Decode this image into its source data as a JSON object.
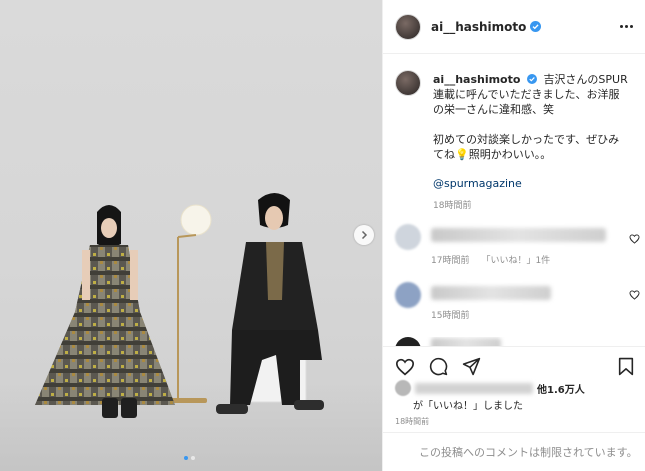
{
  "post": {
    "username": "ai__hashimoto",
    "image_alt": "photo",
    "carousel_dots": 2
  },
  "caption": {
    "username": "ai__hashimoto",
    "text": "吉沢さんのSPUR連載に呼んでいただきました、お洋服の栄一さんに違和感、笑\n\n初めての対談楽しかったです、ぜひみてね💡照明かわいい。。",
    "mention": "@spurmagazine",
    "time": "18時間前"
  },
  "comments": [
    {
      "time": "17時間前",
      "likes_label": "「いいね！」1件"
    },
    {
      "time": "15時間前",
      "likes_label": ""
    }
  ],
  "likes": {
    "others_label": "他1.6万人",
    "suffix": "が「いいね！」しました"
  },
  "timestamp": "18時間前",
  "footer_text": "この投稿へのコメントは制限されています。",
  "colors": {
    "verified": "#3897f0",
    "mention": "#00376b",
    "muted": "#8e8e8e"
  },
  "icons": [
    "verified-badge-icon",
    "more-options-icon",
    "chevron-right-icon",
    "heart-icon",
    "comment-icon",
    "share-icon",
    "bookmark-icon"
  ]
}
